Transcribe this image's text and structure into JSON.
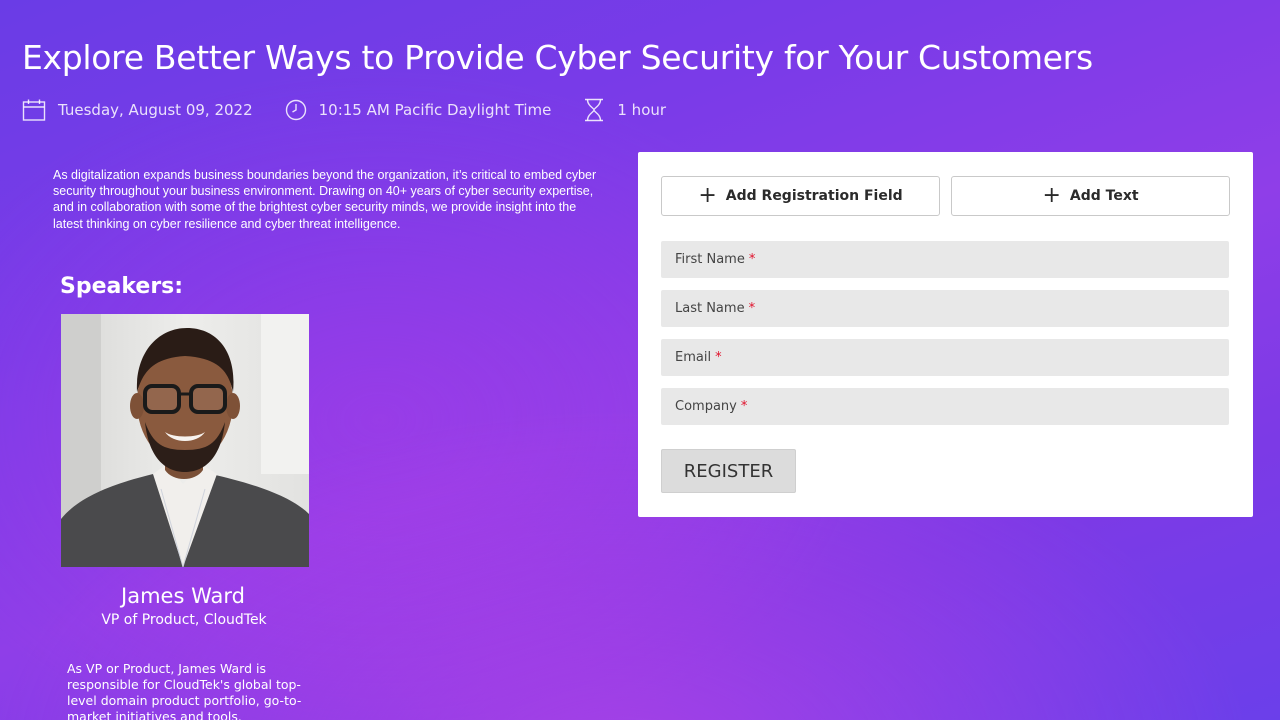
{
  "event": {
    "title": "Explore Better Ways to Provide Cyber Security for Your Customers",
    "date": "Tuesday, August 09, 2022",
    "time": "10:15 AM Pacific Daylight Time",
    "duration": "1 hour",
    "description": "As digitalization expands business boundaries beyond the organization, it’s critical to embed cyber security throughout your business environment. Drawing on 40+ years of cyber security expertise, and in collaboration with some of the brightest cyber security minds, we provide insight into the latest thinking on cyber resilience and cyber threat intelligence."
  },
  "speakers": {
    "heading": "Speakers:",
    "items": [
      {
        "name": "James Ward",
        "role": "VP of Product, CloudTek",
        "bio": "As VP or Product, James Ward is responsible for CloudTek's global top-level domain product portfolio, go-to-market initiatives and tools."
      }
    ]
  },
  "form": {
    "add_field_label": "Add Registration Field",
    "add_text_label": "Add Text",
    "fields": [
      {
        "label": "First Name",
        "required_mark": "*"
      },
      {
        "label": "Last Name",
        "required_mark": "*"
      },
      {
        "label": "Email",
        "required_mark": "*"
      },
      {
        "label": "Company",
        "required_mark": "*"
      }
    ],
    "register_label": "REGISTER"
  },
  "icons": {
    "date": "calendar-icon",
    "time": "clock-icon",
    "duration": "hourglass-icon",
    "add": "plus-icon"
  },
  "colors": {
    "background_primary": "#7b3be8",
    "background_accent": "#c846e6",
    "panel": "#ffffff",
    "field_bg": "#e8e8e8",
    "required": "#e0102a",
    "register_bg": "#dcdcdc"
  }
}
